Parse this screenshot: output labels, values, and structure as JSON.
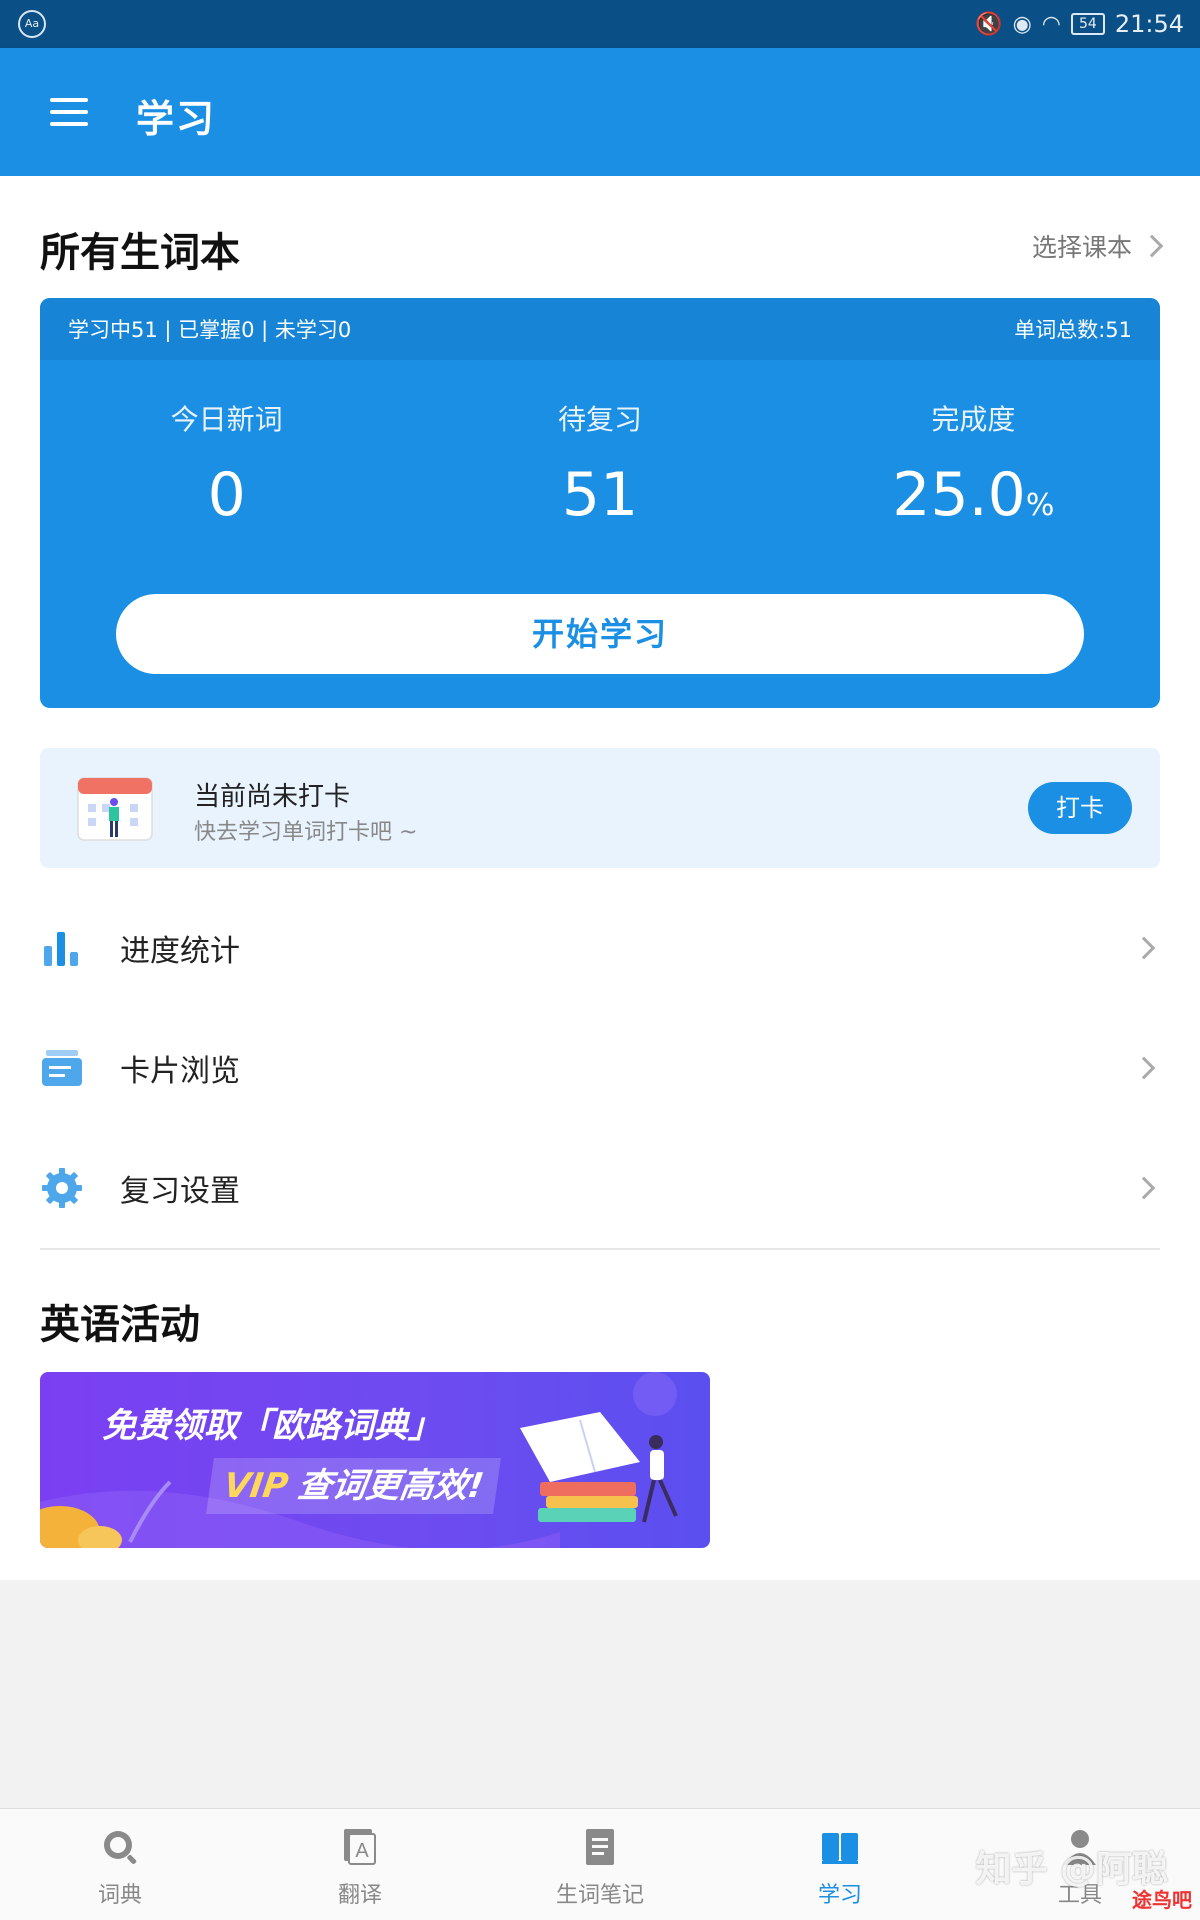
{
  "status_bar": {
    "time": "21:54",
    "battery": "54"
  },
  "app_bar": {
    "title": "学习"
  },
  "vocab": {
    "section_title": "所有生词本",
    "select_book": "选择课本",
    "summary": "学习中51 | 已掌握0 | 未学习0",
    "total": "单词总数:51",
    "stats": [
      {
        "label": "今日新词",
        "value": "0",
        "unit": ""
      },
      {
        "label": "待复习",
        "value": "51",
        "unit": ""
      },
      {
        "label": "完成度",
        "value": "25.0",
        "unit": "%"
      }
    ],
    "start_button": "开始学习"
  },
  "checkin": {
    "title": "当前尚未打卡",
    "subtitle": "快去学习单词打卡吧 ~",
    "button": "打卡"
  },
  "menu": [
    {
      "label": "进度统计",
      "icon": "bar-chart-icon"
    },
    {
      "label": "卡片浏览",
      "icon": "cards-icon"
    },
    {
      "label": "复习设置",
      "icon": "gear-icon"
    }
  ],
  "activities": {
    "section_title": "英语活动",
    "banner_line1": "免费领取「欧路词典」",
    "banner_vip": "VIP",
    "banner_line2": "查词更高效!"
  },
  "bottom_nav": [
    {
      "label": "词典",
      "icon": "search-icon"
    },
    {
      "label": "翻译",
      "icon": "translate-icon"
    },
    {
      "label": "生词笔记",
      "icon": "notes-icon"
    },
    {
      "label": "学习",
      "icon": "book-icon",
      "active": true
    },
    {
      "label": "工具",
      "icon": "person-icon"
    }
  ],
  "watermark": {
    "text": "知乎 @阿聪",
    "logo": "途鸟吧"
  },
  "colors": {
    "primary": "#1a8fe3",
    "status_bar": "#0b4f87"
  }
}
